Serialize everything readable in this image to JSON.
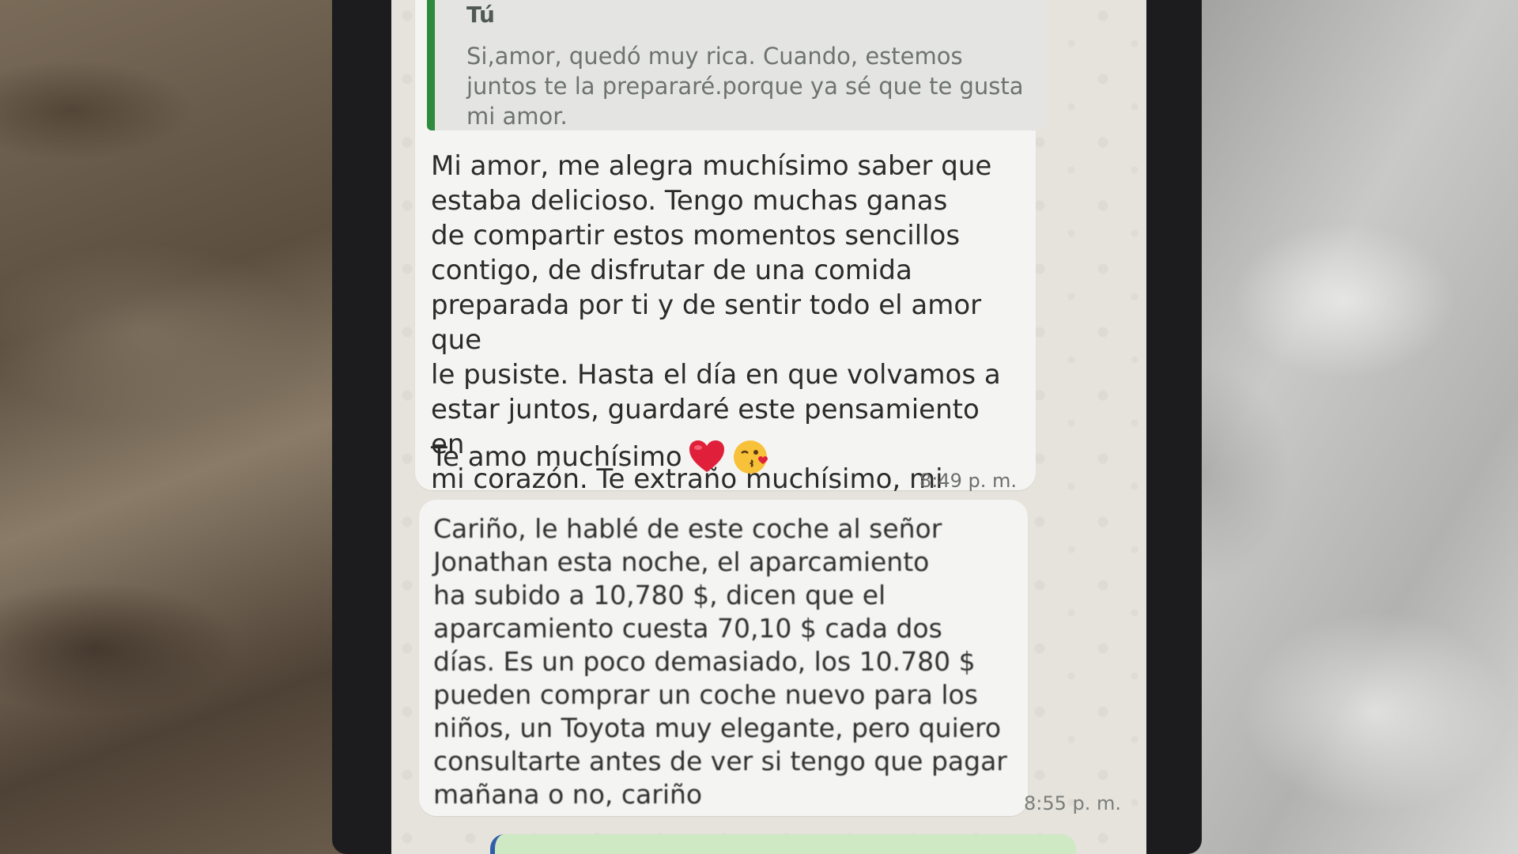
{
  "chat": {
    "quoted_reply": {
      "author": "Tú",
      "text": "Si,amor, quedó muy rica. Cuando, estemos juntos te la prepararé.porque ya sé que te gusta mi amor."
    },
    "messages": [
      {
        "text": "Mi amor, me alegra muchísimo saber que\nestaba delicioso. Tengo muchas ganas\nde compartir estos momentos sencillos\ncontigo, de disfrutar de una comida\npreparada por ti y de sentir todo el amor que\nle pusiste. Hasta el día en que volvamos a\nestar juntos, guardaré este pensamiento en\nmi corazón. Te extraño muchísimo, mi amor.",
        "last_line": "Te amo muchísimo",
        "emojis": [
          "red-heart-icon",
          "face-blowing-kiss-icon"
        ],
        "time": "8:49 p. m."
      },
      {
        "text": "Cariño, le hablé de este coche al señor\nJonathan esta noche, el aparcamiento\nha subido a 10,780 $, dicen que el\naparcamiento cuesta 70,10 $ cada dos\ndías. Es un poco demasiado, los 10.780 $\npueden comprar un coche nuevo para los\nniños, un Toyota muy elegante, pero quiero\nconsultarte antes de ver si tengo que pagar\nmañana o no, cariño",
        "time": "8:55 p. m."
      }
    ]
  },
  "colors": {
    "quote_bar": "#2e8b3e",
    "bubble": "#f4f4f2",
    "outgoing_bubble": "#cfe9c4"
  }
}
